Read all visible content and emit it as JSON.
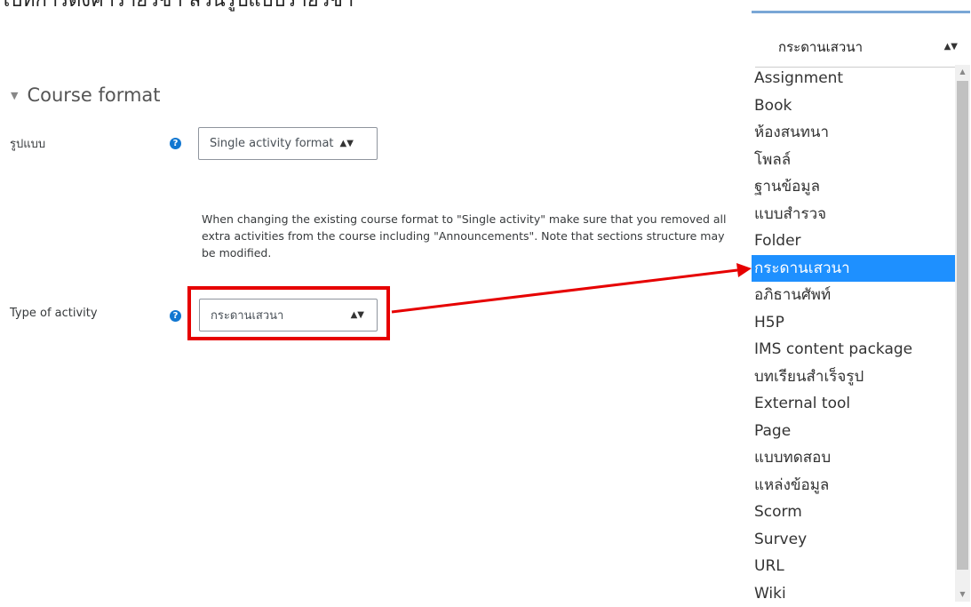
{
  "top_text": "ไปที่การตั้งค่ารายวิชา ส่วนรูปแบบรายวิชา",
  "section": {
    "title": "Course format"
  },
  "format_field": {
    "label": "รูปแบบ",
    "help": "?",
    "value": "Single activity format"
  },
  "note": "When changing the existing course format to \"Single activity\" make sure that you removed all extra activities from the course including \"Announcements\". Note that sections structure may be modified.",
  "activity_field": {
    "label": "Type of activity",
    "help": "?",
    "value": "กระดานเสวนา"
  },
  "dropdown": {
    "selected_value": "กระดานเสวนา",
    "options": [
      "Assignment",
      "Book",
      "ห้องสนทนา",
      "โพลล์",
      "ฐานข้อมูล",
      "แบบสำรวจ",
      "Folder",
      "กระดานเสวนา",
      "อภิธานศัพท์",
      "H5P",
      "IMS content package",
      "บทเรียนสำเร็จรูป",
      "External tool",
      "Page",
      "แบบทดสอบ",
      "แหล่งข้อมูล",
      "Scorm",
      "Survey",
      "URL",
      "Wiki"
    ],
    "highlighted_index": 7
  },
  "colors": {
    "highlight_box": "#e60000",
    "help_icon": "#1177d1",
    "selected_option": "#1e90ff"
  }
}
